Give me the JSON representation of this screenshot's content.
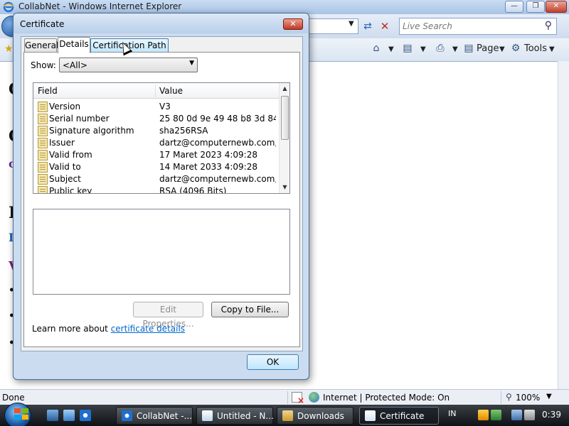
{
  "ie": {
    "window_title": "CollabNet - Windows Internet Explorer",
    "search_placeholder": "Live Search",
    "commands": {
      "page_label": "Page",
      "tools_label": "Tools"
    },
    "status": {
      "left_text": "Done",
      "zone_text": "Internet | Protected Mode: On",
      "zoom": "100%"
    }
  },
  "dialog": {
    "title": "Certificate",
    "tabs": [
      {
        "label": "General",
        "active": false
      },
      {
        "label": "Details",
        "active": true
      },
      {
        "label": "Certification Path",
        "active": false
      }
    ],
    "show_label": "Show:",
    "show_value": "<All>",
    "list_headers": {
      "field": "Field",
      "value": "Value"
    },
    "rows": [
      {
        "field": "Version",
        "value": "V3"
      },
      {
        "field": "Serial number",
        "value": "25 80 0d 9e 49 48 b8 3d 84 3f..."
      },
      {
        "field": "Signature algorithm",
        "value": "sha256RSA"
      },
      {
        "field": "Issuer",
        "value": "dartz@computernewb.com, co..."
      },
      {
        "field": "Valid from",
        "value": "17 Maret 2023 4:09:28"
      },
      {
        "field": "Valid to",
        "value": "14 Maret 2033 4:09:28"
      },
      {
        "field": "Subject",
        "value": "dartz@computernewb.com, co..."
      },
      {
        "field": "Public key",
        "value": "RSA (4096 Bits)"
      }
    ],
    "edit_properties_label": "Edit Properties...",
    "copy_to_file_label": "Copy to File...",
    "learn_more_text": "Learn more about ",
    "learn_more_link": "certificate details",
    "ok_label": "OK"
  },
  "taskbar": {
    "buttons": [
      {
        "label": "CollabNet -...",
        "active": false
      },
      {
        "label": "Untitled - N...",
        "active": false
      },
      {
        "label": "Downloads",
        "active": false
      },
      {
        "label": "Certificate",
        "active": true
      }
    ],
    "language": "IN",
    "clock": "0:39"
  },
  "icons": {
    "ie_logo": "internet-explorer-icon",
    "search": "magnifier-icon",
    "home": "home-icon",
    "feeds": "rss-feed-icon",
    "print": "printer-icon",
    "tools": "gear-icon",
    "field_row": "certificate-field-icon"
  },
  "colors": {
    "link": "#0066cc",
    "close_button": "#c03a22",
    "taskbar": "#1b1f24"
  }
}
